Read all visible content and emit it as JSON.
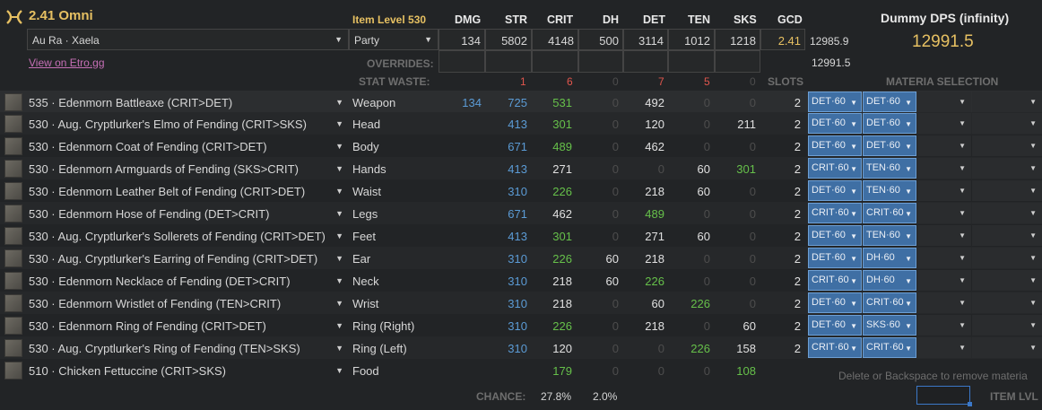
{
  "header": {
    "title": "2.41 Omni",
    "item_level": "Item Level 530",
    "race": "Au Ra · Xaela",
    "food_party": "Party",
    "link": "View on Etro.gg",
    "overrides_label": "OVERRIDES:",
    "stat_waste_label": "STAT WASTE:",
    "slots_label": "SLOTS",
    "materia_label": "MATERIA SELECTION",
    "columns": [
      "DMG",
      "STR",
      "CRIT",
      "DH",
      "DET",
      "TEN",
      "SKS",
      "GCD"
    ],
    "totals": [
      "134",
      "5802",
      "4148",
      "500",
      "3114",
      "1012",
      "1218",
      "2.41"
    ],
    "waste": [
      "1",
      "6",
      "0",
      "7",
      "5",
      "0"
    ],
    "value_a": "12985.9",
    "value_b": "12991.5",
    "dps_title": "Dummy DPS (infinity)",
    "dps_value": "12991.5"
  },
  "gear": [
    {
      "name": "535 · Edenmorn Battleaxe (CRIT>DET)",
      "slot": "Weapon",
      "dmg": "134",
      "str": "725",
      "crit": "531",
      "dh": "0",
      "det": "492",
      "ten": "0",
      "sks": "0",
      "slots": "2",
      "m1": "DET·60",
      "m2": "DET·60"
    },
    {
      "name": "530 · Aug. Cryptlurker's Elmo of Fending (CRIT>SKS)",
      "slot": "Head",
      "dmg": "",
      "str": "413",
      "crit": "301",
      "dh": "0",
      "det": "120",
      "ten": "0",
      "sks": "211",
      "slots": "2",
      "m1": "DET·60",
      "m2": "DET·60"
    },
    {
      "name": "530 · Edenmorn Coat of Fending (CRIT>DET)",
      "slot": "Body",
      "dmg": "",
      "str": "671",
      "crit": "489",
      "dh": "0",
      "det": "462",
      "ten": "0",
      "sks": "0",
      "slots": "2",
      "m1": "DET·60",
      "m2": "DET·60"
    },
    {
      "name": "530 · Edenmorn Armguards of Fending (SKS>CRIT)",
      "slot": "Hands",
      "dmg": "",
      "str": "413",
      "crit": "271",
      "dh": "0",
      "det": "0",
      "ten": "60",
      "sks": "301",
      "slots": "2",
      "m1": "CRIT·60",
      "m2": "TEN·60"
    },
    {
      "name": "530 · Edenmorn Leather Belt of Fending (CRIT>DET)",
      "slot": "Waist",
      "dmg": "",
      "str": "310",
      "crit": "226",
      "dh": "0",
      "det": "218",
      "ten": "60",
      "sks": "0",
      "slots": "2",
      "m1": "DET·60",
      "m2": "TEN·60"
    },
    {
      "name": "530 · Edenmorn Hose of Fending (DET>CRIT)",
      "slot": "Legs",
      "dmg": "",
      "str": "671",
      "crit": "462",
      "dh": "0",
      "det": "489",
      "ten": "0",
      "sks": "0",
      "slots": "2",
      "m1": "CRIT·60",
      "m2": "CRIT·60"
    },
    {
      "name": "530 · Aug. Cryptlurker's Sollerets of Fending (CRIT>DET)",
      "slot": "Feet",
      "dmg": "",
      "str": "413",
      "crit": "301",
      "dh": "0",
      "det": "271",
      "ten": "60",
      "sks": "0",
      "slots": "2",
      "m1": "DET·60",
      "m2": "TEN·60"
    },
    {
      "name": "530 · Aug. Cryptlurker's Earring of Fending (CRIT>DET)",
      "slot": "Ear",
      "dmg": "",
      "str": "310",
      "crit": "226",
      "dh": "60",
      "det": "218",
      "ten": "0",
      "sks": "0",
      "slots": "2",
      "m1": "DET·60",
      "m2": "DH·60"
    },
    {
      "name": "530 · Edenmorn Necklace of Fending (DET>CRIT)",
      "slot": "Neck",
      "dmg": "",
      "str": "310",
      "crit": "218",
      "dh": "60",
      "det": "226",
      "ten": "0",
      "sks": "0",
      "slots": "2",
      "m1": "CRIT·60",
      "m2": "DH·60"
    },
    {
      "name": "530 · Edenmorn Wristlet of Fending (TEN>CRIT)",
      "slot": "Wrist",
      "dmg": "",
      "str": "310",
      "crit": "218",
      "dh": "0",
      "det": "60",
      "ten": "226",
      "sks": "0",
      "slots": "2",
      "m1": "DET·60",
      "m2": "CRIT·60"
    },
    {
      "name": "530 · Edenmorn Ring of Fending (CRIT>DET)",
      "slot": "Ring (Right)",
      "dmg": "",
      "str": "310",
      "crit": "226",
      "dh": "0",
      "det": "218",
      "ten": "0",
      "sks": "60",
      "slots": "2",
      "m1": "DET·60",
      "m2": "SKS·60"
    },
    {
      "name": "530 · Aug. Cryptlurker's Ring of Fending (TEN>SKS)",
      "slot": "Ring (Left)",
      "dmg": "",
      "str": "310",
      "crit": "120",
      "dh": "0",
      "det": "0",
      "ten": "226",
      "sks": "158",
      "slots": "2",
      "m1": "CRIT·60",
      "m2": "CRIT·60"
    },
    {
      "name": "510 · Chicken Fettuccine (CRIT>SKS)",
      "slot": "Food",
      "dmg": "",
      "str": "",
      "crit": "179",
      "dh": "0",
      "det": "0",
      "ten": "0",
      "sks": "108",
      "slots": "",
      "m1": "",
      "m2": ""
    }
  ],
  "footer": {
    "chance_label": "CHANCE:",
    "crit_chance": "27.8%",
    "dh_chance": "2.0%",
    "hint": "Delete or Backspace to remove materia",
    "item_lvl_label": "ITEM LVL"
  },
  "colors": {
    "materia_fill": "#3f6fa4",
    "stat_blue": "#5b9bd5",
    "stat_green": "#66c04a",
    "waste_red": "#e0564d",
    "gold": "#e6c062"
  }
}
